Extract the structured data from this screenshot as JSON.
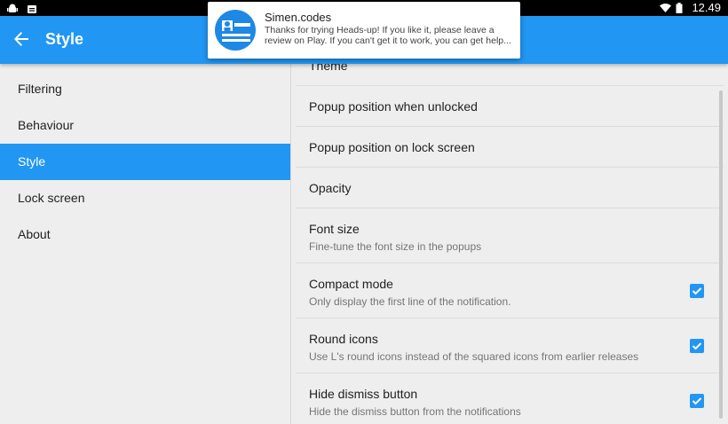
{
  "status_bar": {
    "time": "12.49",
    "left_icons": [
      "android-icon",
      "notification-app-icon"
    ],
    "right_icons": [
      "wifi-icon",
      "battery-icon"
    ]
  },
  "app_bar": {
    "title": "Style",
    "back_icon": "arrow-back-icon",
    "color": "#2196f3"
  },
  "nav": {
    "items": [
      {
        "label": "Filtering",
        "active": false
      },
      {
        "label": "Behaviour",
        "active": false
      },
      {
        "label": "Style",
        "active": true
      },
      {
        "label": "Lock screen",
        "active": false
      },
      {
        "label": "About",
        "active": false
      }
    ]
  },
  "settings": {
    "items": [
      {
        "title": "Theme",
        "summary": "",
        "checked": null
      },
      {
        "title": "Popup position when unlocked",
        "summary": "",
        "checked": null
      },
      {
        "title": "Popup position on lock screen",
        "summary": "",
        "checked": null
      },
      {
        "title": "Opacity",
        "summary": "",
        "checked": null
      },
      {
        "title": "Font size",
        "summary": "Fine-tune the font size in the popups",
        "checked": null
      },
      {
        "title": "Compact mode",
        "summary": "Only display the first line of the notification.",
        "checked": true
      },
      {
        "title": "Round icons",
        "summary": "Use L's round icons instead of the squared icons from earlier releases",
        "checked": true
      },
      {
        "title": "Hide dismiss button",
        "summary": "Hide the dismiss button from the notifications",
        "checked": true
      }
    ]
  },
  "notification": {
    "title": "Simen.codes",
    "text_line1": "Thanks for trying Heads-up! If you like it, please leave a",
    "text_line2": "review on Play. If you can't get it to work, you can get help...",
    "icon": "heads-up-app-icon"
  }
}
